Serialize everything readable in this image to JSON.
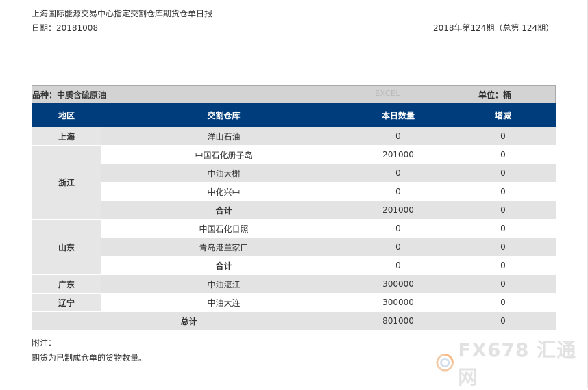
{
  "header": {
    "title": "上海国际能源交易中心指定交割仓库期货仓单日报",
    "date": "日期：20181008",
    "issue": "2018年第124期（总第 124期）"
  },
  "meta": {
    "variety": "品种：中质含硫原油",
    "excel": "EXCEL",
    "unit": "单位：桶"
  },
  "columns": [
    "地区",
    "交割仓库",
    "本日数量",
    "增减"
  ],
  "regions": {
    "shanghai": "上海",
    "zhejiang": "浙江",
    "shandong": "山东",
    "guangdong": "广东",
    "liaoning": "辽宁"
  },
  "rows": [
    {
      "warehouse": "洋山石油",
      "qty": "0",
      "change": "0"
    },
    {
      "warehouse": "中国石化册子岛",
      "qty": "201000",
      "change": "0"
    },
    {
      "warehouse": "中油大榭",
      "qty": "0",
      "change": "0"
    },
    {
      "warehouse": "中化兴中",
      "qty": "0",
      "change": "0"
    },
    {
      "warehouse": "合计",
      "qty": "201000",
      "change": "0"
    },
    {
      "warehouse": "中国石化日照",
      "qty": "0",
      "change": "0"
    },
    {
      "warehouse": "青岛港董家口",
      "qty": "0",
      "change": "0"
    },
    {
      "warehouse": "合计",
      "qty": "0",
      "change": "0"
    },
    {
      "warehouse": "中油湛江",
      "qty": "300000",
      "change": "0"
    },
    {
      "warehouse": "中油大连",
      "qty": "300000",
      "change": "0"
    }
  ],
  "total": {
    "label": "总计",
    "qty": "801000",
    "change": "0"
  },
  "notes": {
    "label": "附注：",
    "text": "期货为已制成仓单的货物数量。"
  },
  "watermark": {
    "text": "FX678 汇通网",
    "icon": "fx678-logo-icon"
  }
}
